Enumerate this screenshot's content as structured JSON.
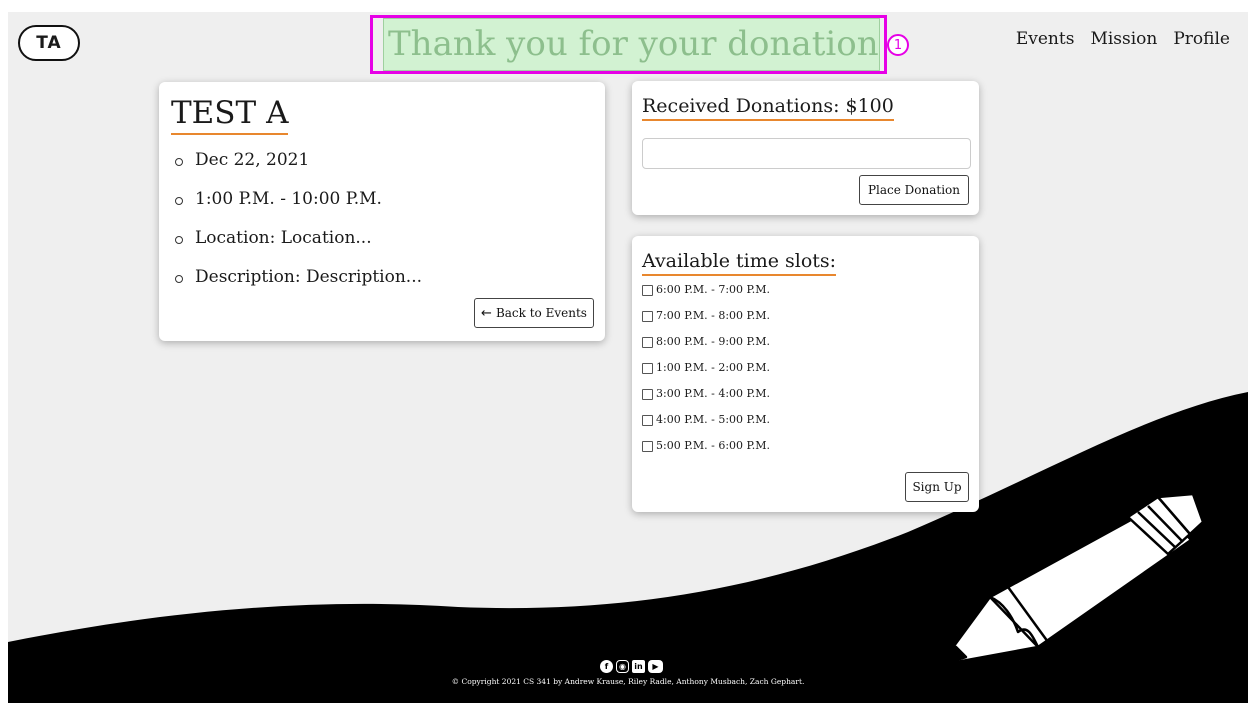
{
  "header": {
    "logo_text": "TA",
    "nav": [
      "Events",
      "Mission",
      "Profile"
    ],
    "banner_text": "Thank you for your donation",
    "banner_badge": "1"
  },
  "event": {
    "title": "TEST A",
    "date": "Dec 22, 2021",
    "time": "1:00 P.M. - 10:00 P.M.",
    "location": "Location: Location...",
    "description": "Description: Description...",
    "back_button": "Back to Events"
  },
  "donations": {
    "heading": "Received Donations: $100",
    "input_value": "",
    "button": "Place Donation"
  },
  "slots": {
    "heading": "Available time slots:",
    "items": [
      "6:00 P.M. - 7:00 P.M.",
      "7:00 P.M. - 8:00 P.M.",
      "8:00 P.M. - 9:00 P.M.",
      "1:00 P.M. - 2:00 P.M.",
      "3:00 P.M. - 4:00 P.M.",
      "4:00 P.M. - 5:00 P.M.",
      "5:00 P.M. - 6:00 P.M."
    ],
    "button": "Sign Up"
  },
  "footer": {
    "social_icons": [
      "facebook-icon",
      "instagram-icon",
      "linkedin-icon",
      "youtube-icon"
    ],
    "copyright": "© Copyright 2021 CS 341 by Andrew Krause, Riley Radle, Anthony Musbach, Zach Gephart."
  },
  "colors": {
    "accent_underline": "#e8872e",
    "banner_bg": "#d2f2d2",
    "banner_text": "#8dbf8d",
    "highlight_outline": "#e600e6"
  }
}
